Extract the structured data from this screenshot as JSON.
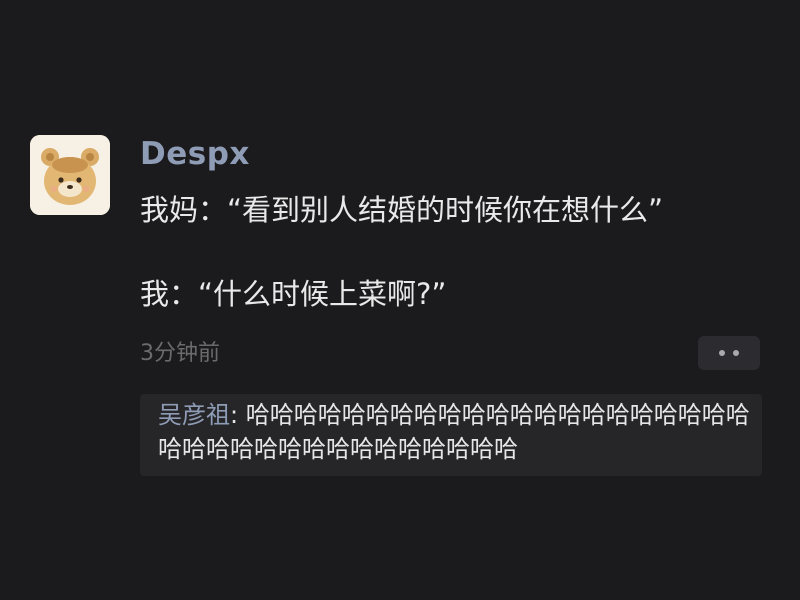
{
  "post": {
    "username": "Despx",
    "content_line_1": "我妈：“看到别人结婚的时候你在想什么”",
    "content_line_2": "我：“什么时候上菜啊?”",
    "timestamp": "3分钟前"
  },
  "icons": {
    "avatar": "cartoon-bear-avatar",
    "more": "more-dots-icon"
  },
  "comment": {
    "author": "吴彦祖",
    "separator": ": ",
    "text": "哈哈哈哈哈哈哈哈哈哈哈哈哈哈哈哈哈哈哈哈哈哈哈哈哈哈哈哈哈哈哈哈哈哈哈哈"
  },
  "colors": {
    "background": "#1b1b1d",
    "username": "#8e9cb6",
    "content": "#e9e9e9",
    "timestamp": "#6b6b6f",
    "comment_background": "#262629"
  }
}
